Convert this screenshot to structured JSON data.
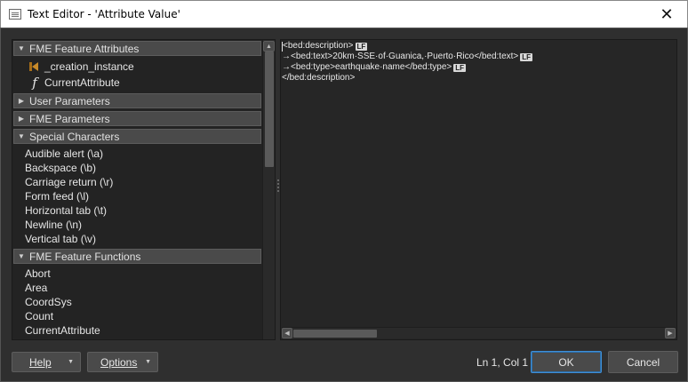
{
  "window": {
    "title": "Text Editor - 'Attribute Value'",
    "close_glyph": "✕"
  },
  "sidebar": {
    "groups": [
      {
        "label": "FME Feature Attributes",
        "expanded": true,
        "items": [
          {
            "label": "_creation_instance",
            "icon": "attribute-icon"
          },
          {
            "label": "CurrentAttribute",
            "icon": "function-icon"
          }
        ]
      },
      {
        "label": "User Parameters",
        "expanded": false,
        "items": []
      },
      {
        "label": "FME Parameters",
        "expanded": false,
        "items": []
      },
      {
        "label": "Special Characters",
        "expanded": true,
        "items": [
          {
            "label": "Audible alert (\\a)"
          },
          {
            "label": "Backspace (\\b)"
          },
          {
            "label": "Carriage return (\\r)"
          },
          {
            "label": "Form feed (\\l)"
          },
          {
            "label": "Horizontal tab (\\t)"
          },
          {
            "label": "Newline (\\n)"
          },
          {
            "label": "Vertical tab (\\v)"
          }
        ]
      },
      {
        "label": "FME Feature Functions",
        "expanded": true,
        "items": [
          {
            "label": "Abort"
          },
          {
            "label": "Area"
          },
          {
            "label": "CoordSys"
          },
          {
            "label": "Count"
          },
          {
            "label": "CurrentAttribute"
          }
        ]
      }
    ]
  },
  "editor": {
    "lines": [
      {
        "text": "<bed:description>",
        "eol": "LF"
      },
      {
        "text": "→<bed:text>20km·SSE·of·Guanica,·Puerto·Rico</bed:text>",
        "eol": "LF"
      },
      {
        "text": "→<bed:type>earthquake·name</bed:type>",
        "eol": "LF"
      },
      {
        "text": "</bed:description>",
        "eol": ""
      }
    ]
  },
  "footer": {
    "help_label": "Help",
    "options_label": "Options",
    "cursor_position": "Ln 1, Col 1",
    "ok_label": "OK",
    "cancel_label": "Cancel"
  },
  "colors": {
    "background": "#2f2f2f",
    "panel": "#232323",
    "accent": "#3f8fd6",
    "attribute_icon": "#c88a2a"
  }
}
